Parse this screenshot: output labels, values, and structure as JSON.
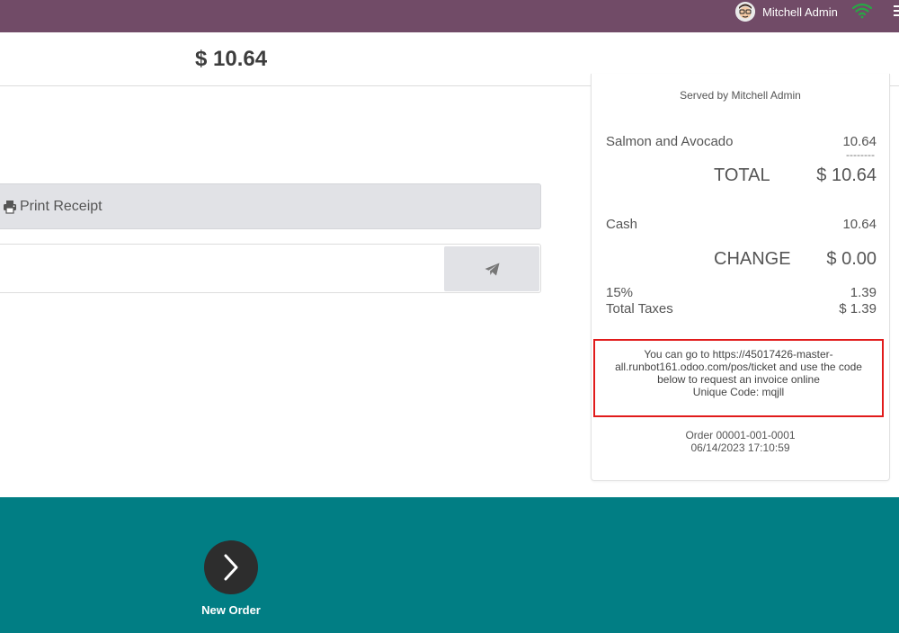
{
  "navbar": {
    "user_name": "Mitchell Admin",
    "bg_color": "#714b67"
  },
  "header": {
    "total": "$ 10.64"
  },
  "actions": {
    "print_label": "Print Receipt",
    "email_placeholder": "",
    "send_icon": "paper-plane-icon"
  },
  "receipt": {
    "served_by": "Served by Mitchell Admin",
    "lines": [
      {
        "name": "Salmon and Avocado",
        "price": "10.64"
      }
    ],
    "dashes": "--------",
    "total_label": "TOTAL",
    "total_value": "$ 10.64",
    "payments": [
      {
        "method": "Cash",
        "amount": "10.64"
      }
    ],
    "change_label": "CHANGE",
    "change_value": "$ 0.00",
    "tax_rate": "15%",
    "tax_rate_amount": "1.39",
    "total_taxes_label": "Total Taxes",
    "total_taxes_value": "$ 1.39",
    "invoice_line1": "You can go to https://45017426-master-",
    "invoice_line2": "all.runbot161.odoo.com/pos/ticket and use the code",
    "invoice_line3": "below to request an invoice online",
    "unique_code": "Unique Code: mqjll",
    "order_number": "Order 00001-001-0001",
    "order_datetime": "06/14/2023 17:10:59"
  },
  "footer": {
    "new_order_label": "New Order",
    "bg_color": "#017e84"
  }
}
